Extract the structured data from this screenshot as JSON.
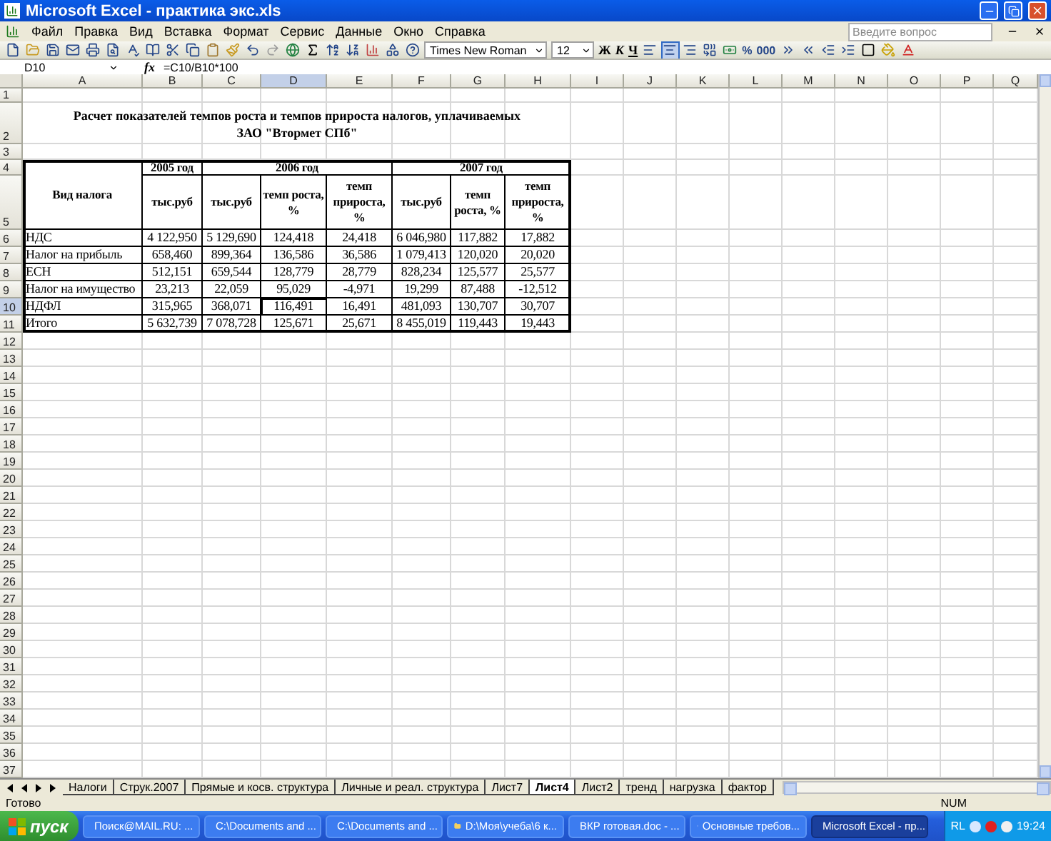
{
  "window": {
    "title": "Microsoft Excel - практика экс.xls"
  },
  "menu": {
    "items": [
      "Файл",
      "Правка",
      "Вид",
      "Вставка",
      "Формат",
      "Сервис",
      "Данные",
      "Окно",
      "Справка"
    ],
    "help_placeholder": "Введите вопрос"
  },
  "toolbar": {
    "font": "Times New Roman",
    "size": "12",
    "format_buttons": [
      {
        "label": "Ж",
        "kind": "bold"
      },
      {
        "label": "К",
        "kind": "italic"
      },
      {
        "label": "Ч",
        "kind": "underline"
      }
    ],
    "number_buttons": [
      "%",
      "000"
    ]
  },
  "formula_bar": {
    "name_box": "D10",
    "function_label": "fx",
    "formula": "=C10/B10*100"
  },
  "sheet": {
    "columns": [
      {
        "label": "A",
        "selected": false
      },
      {
        "label": "B",
        "selected": false
      },
      {
        "label": "C",
        "selected": false
      },
      {
        "label": "D",
        "selected": true
      },
      {
        "label": "E",
        "selected": false
      },
      {
        "label": "F",
        "selected": false
      },
      {
        "label": "G",
        "selected": false
      },
      {
        "label": "H",
        "selected": false
      },
      {
        "label": "I",
        "selected": false
      },
      {
        "label": "J",
        "selected": false
      },
      {
        "label": "K",
        "selected": false
      },
      {
        "label": "L",
        "selected": false
      },
      {
        "label": "M",
        "selected": false
      },
      {
        "label": "N",
        "selected": false
      },
      {
        "label": "O",
        "selected": false
      },
      {
        "label": "P",
        "selected": false
      },
      {
        "label": "Q",
        "selected": false
      }
    ],
    "rows": [
      {
        "label": "1",
        "selected": false
      },
      {
        "label": "2",
        "selected": false
      },
      {
        "label": "3",
        "selected": false
      },
      {
        "label": "4",
        "selected": false
      },
      {
        "label": "5",
        "selected": false
      },
      {
        "label": "6",
        "selected": false
      },
      {
        "label": "7",
        "selected": false
      },
      {
        "label": "8",
        "selected": false
      },
      {
        "label": "9",
        "selected": false
      },
      {
        "label": "10",
        "selected": true
      },
      {
        "label": "11",
        "selected": false
      },
      {
        "label": "12",
        "selected": false
      },
      {
        "label": "13",
        "selected": false
      },
      {
        "label": "14",
        "selected": false
      },
      {
        "label": "15",
        "selected": false
      },
      {
        "label": "16",
        "selected": false
      },
      {
        "label": "17",
        "selected": false
      },
      {
        "label": "18",
        "selected": false
      },
      {
        "label": "19",
        "selected": false
      },
      {
        "label": "20",
        "selected": false
      },
      {
        "label": "21",
        "selected": false
      },
      {
        "label": "22",
        "selected": false
      },
      {
        "label": "23",
        "selected": false
      },
      {
        "label": "24",
        "selected": false
      },
      {
        "label": "25",
        "selected": false
      },
      {
        "label": "26",
        "selected": false
      },
      {
        "label": "27",
        "selected": false
      },
      {
        "label": "28",
        "selected": false
      },
      {
        "label": "29",
        "selected": false
      },
      {
        "label": "30",
        "selected": false
      },
      {
        "label": "31",
        "selected": false
      },
      {
        "label": "32",
        "selected": false
      },
      {
        "label": "33",
        "selected": false
      },
      {
        "label": "34",
        "selected": false
      },
      {
        "label": "35",
        "selected": false
      },
      {
        "label": "36",
        "selected": false
      },
      {
        "label": "37",
        "selected": false
      }
    ]
  },
  "report": {
    "title_lines": [
      "Расчет показателей темпов роста и темпов прироста налогов, уплачиваемых",
      "ЗАО \"Втормет СПб\""
    ],
    "table": {
      "name_header": "Вид налога",
      "years": [
        {
          "label": "2005 год",
          "columns": [
            "тыс.руб"
          ]
        },
        {
          "label": "2006 год",
          "columns": [
            "тыс.руб",
            "темп роста, %",
            "темп прироста, %"
          ]
        },
        {
          "label": "2007 год",
          "columns": [
            "тыс.руб",
            "темп роста, %",
            "темп прироста, %"
          ]
        }
      ],
      "rows": [
        {
          "name": "НДС",
          "values": [
            "4 122,950",
            "5 129,690",
            "124,418",
            "24,418",
            "6 046,980",
            "117,882",
            "17,882"
          ]
        },
        {
          "name": "Налог на прибыль",
          "values": [
            "658,460",
            "899,364",
            "136,586",
            "36,586",
            "1 079,413",
            "120,020",
            "20,020"
          ]
        },
        {
          "name": "ЕСН",
          "values": [
            "512,151",
            "659,544",
            "128,779",
            "28,779",
            "828,234",
            "125,577",
            "25,577"
          ]
        },
        {
          "name": "Налог на имущество",
          "values": [
            "23,213",
            "22,059",
            "95,029",
            "-4,971",
            "19,299",
            "87,488",
            "-12,512"
          ]
        },
        {
          "name": "НДФЛ",
          "values": [
            "315,965",
            "368,071",
            "116,491",
            "16,491",
            "481,093",
            "130,707",
            "30,707"
          ]
        },
        {
          "name": "Итого",
          "values": [
            "5 632,739",
            "7 078,728",
            "125,671",
            "25,671",
            "8 455,019",
            "119,443",
            "19,443"
          ]
        }
      ]
    }
  },
  "sheet_tabs": [
    {
      "label": "Налоги",
      "selected": false
    },
    {
      "label": "Струк.2007",
      "selected": false
    },
    {
      "label": "Прямые и косв. структура",
      "selected": false
    },
    {
      "label": "Личные и реал. структура",
      "selected": false
    },
    {
      "label": "Лист7",
      "selected": false
    },
    {
      "label": "Лист4",
      "selected": true
    },
    {
      "label": "Лист2",
      "selected": false
    },
    {
      "label": "тренд",
      "selected": false
    },
    {
      "label": "нагрузка",
      "selected": false
    },
    {
      "label": "фактор",
      "selected": false
    }
  ],
  "status_bar": {
    "text": "Готово",
    "num": "NUM"
  },
  "taskbar": {
    "start": "пуск",
    "items": [
      {
        "label": "Поиск@MAIL.RU: ...",
        "kind": "browser",
        "selected": false
      },
      {
        "label": "C:\\Documents and ...",
        "kind": "folder",
        "selected": false
      },
      {
        "label": "C:\\Documents and ...",
        "kind": "folder",
        "selected": false
      },
      {
        "label": "D:\\Моя\\учеба\\6 к...",
        "kind": "folder",
        "selected": false
      },
      {
        "label": "ВКР готовая.doc - ...",
        "kind": "word",
        "selected": false
      },
      {
        "label": "Основные требов...",
        "kind": "document",
        "selected": false
      },
      {
        "label": "Microsoft Excel - пр...",
        "kind": "excel",
        "selected": true
      }
    ],
    "tray": {
      "language": "RL",
      "time": "19:24"
    }
  }
}
